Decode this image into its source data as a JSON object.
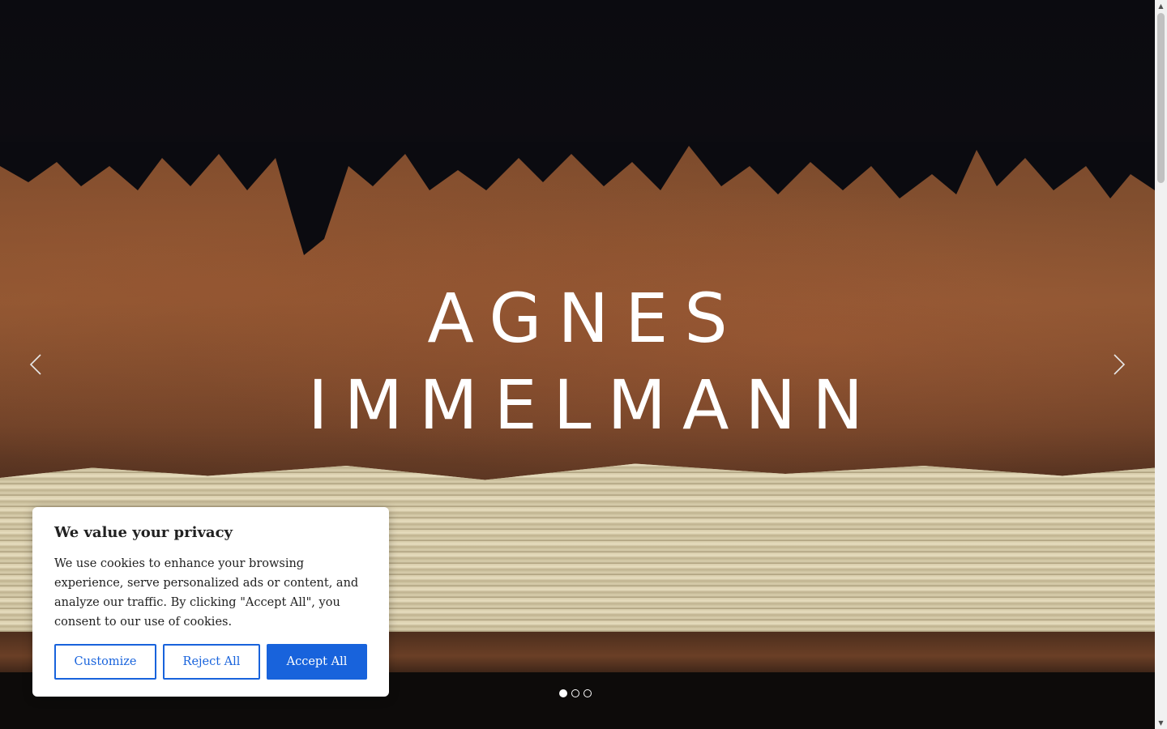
{
  "hero": {
    "title_line1": "AGNES",
    "title_line2": "IMMELMANN",
    "prev_icon": "chevron-left-icon",
    "next_icon": "chevron-right-icon",
    "slides": 3,
    "active_slide": 1
  },
  "cookie_banner": {
    "title": "We value your privacy",
    "body": "We use cookies to enhance your browsing experience, serve personalized ads or content, and analyze our traffic. By clicking \"Accept All\", you consent to our use of cookies.",
    "customize_label": "Customize",
    "reject_label": "Reject All",
    "accept_label": "Accept All",
    "accent_color": "#1863dc"
  }
}
